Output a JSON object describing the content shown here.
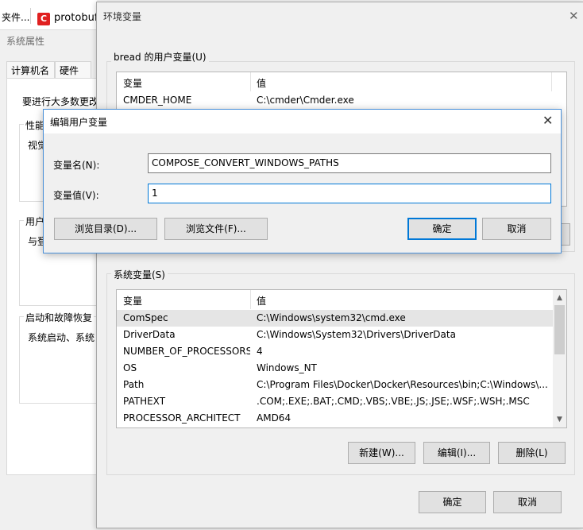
{
  "background": {
    "top_strip": {
      "truncated_text": "夹件...",
      "app_icon_letter": "C",
      "app_title": "protobuf-"
    },
    "system_properties": {
      "title": "系统属性",
      "tabs": [
        "计算机名",
        "硬件"
      ],
      "intro_text": "要进行大多数更改",
      "performance_label": "性能",
      "performance_text": "视觉",
      "user_profile_label": "用户",
      "user_profile_text": "与登",
      "startup_label": "启动和故障恢复",
      "startup_text": "系统启动、系统"
    }
  },
  "env_window": {
    "title": "环境变量",
    "user_section": {
      "label": "bread 的用户变量(U)",
      "col_name": "变量",
      "col_value": "值",
      "rows": [
        {
          "name": "CMDER_HOME",
          "value": "C:\\cmder\\Cmder.exe"
        }
      ]
    },
    "system_section": {
      "label": "系统变量(S)",
      "col_name": "变量",
      "col_value": "值",
      "rows": [
        {
          "name": "ComSpec",
          "value": "C:\\Windows\\system32\\cmd.exe"
        },
        {
          "name": "DriverData",
          "value": "C:\\Windows\\System32\\Drivers\\DriverData"
        },
        {
          "name": "NUMBER_OF_PROCESSORS",
          "value": "4"
        },
        {
          "name": "OS",
          "value": "Windows_NT"
        },
        {
          "name": "Path",
          "value": "C:\\Program Files\\Docker\\Docker\\Resources\\bin;C:\\Windows\\..."
        },
        {
          "name": "PATHEXT",
          "value": ".COM;.EXE;.BAT;.CMD;.VBS;.VBE;.JS;.JSE;.WSF;.WSH;.MSC"
        },
        {
          "name": "PROCESSOR_ARCHITECT",
          "value": "AMD64"
        }
      ],
      "buttons": {
        "new": "新建(W)...",
        "edit": "编辑(I)...",
        "delete": "删除(L)"
      }
    },
    "buttons": {
      "ok": "确定",
      "cancel": "取消"
    }
  },
  "edit_dialog": {
    "title": "编辑用户变量",
    "name_label": "变量名(N):",
    "name_value": "COMPOSE_CONVERT_WINDOWS_PATHS",
    "value_label": "变量值(V):",
    "value_value": "1",
    "buttons": {
      "browse_dir": "浏览目录(D)...",
      "browse_file": "浏览文件(F)...",
      "ok": "确定",
      "cancel": "取消"
    }
  },
  "icons": {
    "close": "close-icon",
    "scroll_up": "chevron-up-icon",
    "scroll_down": "chevron-down-icon"
  },
  "colors": {
    "focus_border": "#0078d7",
    "selected_row": "#e5e5e5",
    "dialog_border": "#4a90d9"
  }
}
